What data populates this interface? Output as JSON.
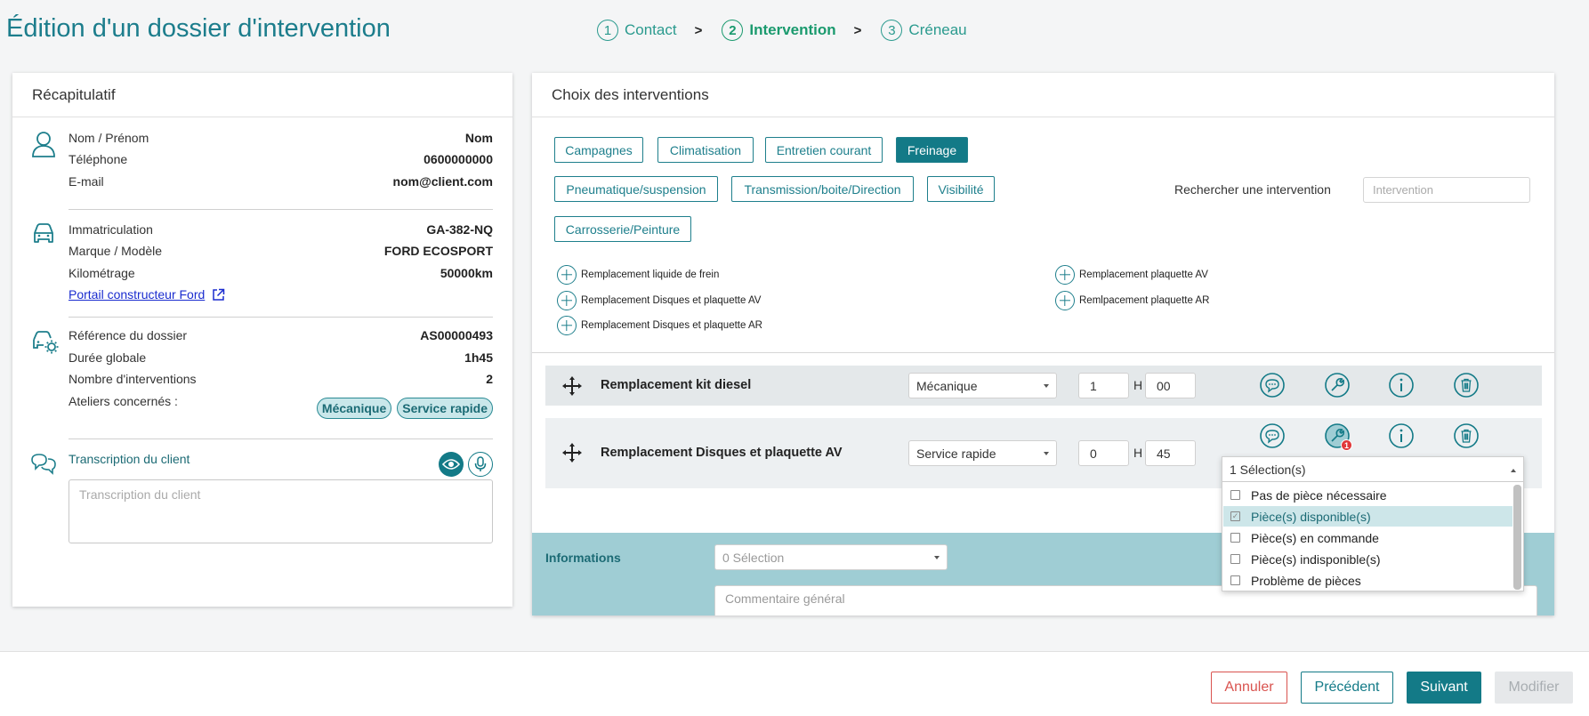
{
  "page": {
    "title": "Édition d'un dossier d'intervention"
  },
  "stepper": [
    {
      "num": "1",
      "label": "Contact"
    },
    {
      "num": "2",
      "label": "Intervention"
    },
    {
      "num": "3",
      "label": "Créneau"
    }
  ],
  "stepper_sep": ">",
  "recap": {
    "title": "Récapitulatif",
    "contact": [
      {
        "label": "Nom / Prénom",
        "value": "Nom"
      },
      {
        "label": "Téléphone",
        "value": "0600000000"
      },
      {
        "label": "E-mail",
        "value": "nom@client.com"
      }
    ],
    "vehicle": [
      {
        "label": "Immatriculation",
        "value": "GA-382-NQ"
      },
      {
        "label": "Marque / Modèle",
        "value": "FORD ECOSPORT"
      },
      {
        "label": "Kilométrage",
        "value": "50000km"
      }
    ],
    "portal_link": "Portail constructeur Ford",
    "dossier": [
      {
        "label": "Référence du dossier",
        "value": "AS00000493"
      },
      {
        "label": "Durée globale",
        "value": "1h45"
      },
      {
        "label": "Nombre d'interventions",
        "value": "2"
      }
    ],
    "ateliers_label": "Ateliers concernés :",
    "ateliers": [
      "Mécanique",
      "Service rapide"
    ],
    "transcription_label": "Transcription du client",
    "transcription_placeholder": "Transcription du client"
  },
  "choix": {
    "title": "Choix des interventions",
    "categories": [
      "Campagnes",
      "Climatisation",
      "Entretien courant",
      "Freinage",
      "Pneumatique/suspension",
      "Transmission/boite/Direction",
      "Visibilité",
      "Carrosserie/Peinture"
    ],
    "active_category": "Freinage",
    "search_label": "Rechercher une intervention",
    "search_placeholder": "Intervention",
    "available": [
      "Remplacement liquide de frein",
      "Remplacement Disques et plaquette AV",
      "Remplacement Disques et plaquette AR",
      "Remplacement plaquette AV",
      "Remlpacement plaquette AR"
    ],
    "selected": [
      {
        "name": "Remplacement kit diesel",
        "atelier": "Mécanique",
        "hours": "1",
        "minutes": "00"
      },
      {
        "name": "Remplacement Disques et plaquette AV",
        "atelier": "Service rapide",
        "hours": "0",
        "minutes": "45",
        "parts_badge": "1"
      }
    ],
    "hour_label": "H",
    "informations_label": "Informations",
    "informations_value": "0 Sélection",
    "comment_placeholder": "Commentaire général"
  },
  "parts_dropdown": {
    "header": "1 Sélection(s)",
    "options": [
      {
        "label": "Pas de pièce nécessaire",
        "checked": false
      },
      {
        "label": "Pièce(s) disponible(s)",
        "checked": true
      },
      {
        "label": "Pièce(s) en commande",
        "checked": false
      },
      {
        "label": "Pièce(s) indisponible(s)",
        "checked": false
      },
      {
        "label": "Problème de pièces",
        "checked": false
      }
    ]
  },
  "footer": {
    "cancel": "Annuler",
    "previous": "Précédent",
    "next": "Suivant",
    "modify": "Modifier"
  },
  "colors": {
    "primary": "#137a87",
    "accent": "#2a9a8e",
    "danger": "#d9534f",
    "band": "#9fcdd4"
  }
}
